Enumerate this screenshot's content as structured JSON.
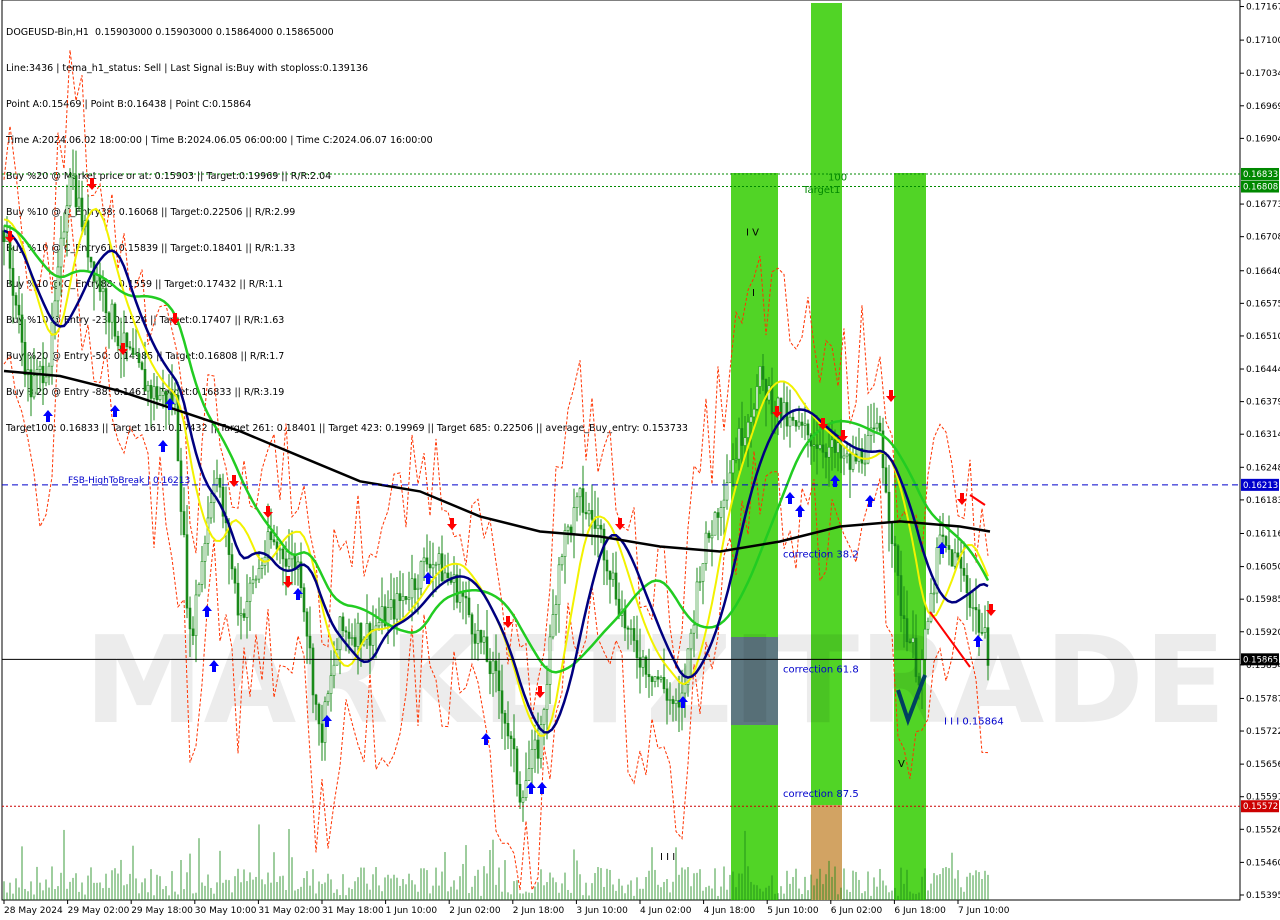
{
  "info_lines": [
    "DOGEUSD-Bin,H1  0.15903000 0.15903000 0.15864000 0.15865000",
    "Line:3436 | tema_h1_status: Sell | Last Signal is:Buy with stoploss:0.139136",
    "Point A:0.15469 | Point B:0.16438 | Point C:0.15864",
    "Time A:2024.06.02 18:00:00 | Time B:2024.06.05 06:00:00 | Time C:2024.06.07 16:00:00",
    "Buy %20 @ Market price or at: 0.15903 || Target:0.19969 || R/R:2.04",
    "Buy %10 @ C_Entry38: 0.16068 || Target:0.22506 || R/R:2.99",
    "Buy %10 @ C_Entry61: 0.15839 || Target:0.18401 || R/R:1.33",
    "Buy %10 @ C_Entry88: 0.1559 || Target:0.17432 || R/R:1.1",
    "Buy %10 @ Entry -23: 0.1524 || Target:0.17407 || R/R:1.63",
    "Buy %20 @ Entry -50: 0.14985 || Target:0.16808 || R/R:1.7",
    "Buy %20 @ Entry -88: 0.1461 || Target:0.16833 || R/R:3.19",
    "Target100: 0.16833 || Target 161: 0.17432 || Target 261: 0.18401 || Target 423: 0.19969 || Target 685: 0.22506 || average_Buy_entry: 0.153733"
  ],
  "colors": {
    "background": "#ffffff",
    "green_band": "#33cc00",
    "blue_box": "#5f6e8c",
    "orange_box": "#d9a066",
    "candle": "#1a8a1a",
    "ma200": "#000000",
    "ma_green": "#22cc22",
    "ma_navy": "#000080",
    "ma_yellow": "#f2f200",
    "envelope": "#ff3300",
    "hline_blue": "#0000cc",
    "hline_green": "#008800",
    "hline_red": "#cc0000",
    "up_arrow": "#0000ff",
    "down_arrow": "#ff0000",
    "price_tag_dark": "#000000",
    "price_tag_blue": "#0000cc",
    "price_tag_green": "#008800",
    "price_tag_red": "#cc0000"
  },
  "watermark": "MARKETZITRADE",
  "chart_data": {
    "type": "candlestick",
    "symbol": "DOGEUSD-Bin",
    "timeframe": "H1",
    "y_ticks": [
      "0.17167",
      "0.17100",
      "0.17034",
      "0.16969",
      "0.16904",
      "0.16833",
      "0.16808",
      "0.16773",
      "0.16708",
      "0.16640",
      "0.16575",
      "0.16510",
      "0.16444",
      "0.16379",
      "0.16314",
      "0.16248",
      "0.16213",
      "0.16183",
      "0.16116",
      "0.16050",
      "0.15985",
      "0.15920",
      "0.15865",
      "0.15854",
      "0.15787",
      "0.15722",
      "0.15656",
      "0.15591",
      "0.15572",
      "0.15526",
      "0.15460",
      "0.15395"
    ],
    "y_range": [
      0.15385,
      0.1718
    ],
    "x_labels": [
      "28 May 2024",
      "29 May 02:00",
      "29 May 18:00",
      "30 May 10:00",
      "31 May 02:00",
      "31 May 18:00",
      "1 Jun 10:00",
      "2 Jun 02:00",
      "2 Jun 18:00",
      "3 Jun 10:00",
      "4 Jun 02:00",
      "4 Jun 18:00",
      "5 Jun 10:00",
      "6 Jun 02:00",
      "6 Jun 18:00",
      "7 Jun 10:00"
    ],
    "horizontal_lines": [
      {
        "label": "FSB-HighToBreak | 0.16213",
        "value": 0.16213,
        "style": "dashed",
        "color": "#0000cc",
        "tag": "0.16213"
      },
      {
        "label": "",
        "value": 0.16833,
        "style": "dotted",
        "color": "#008800",
        "tag": "0.16833"
      },
      {
        "label": "",
        "value": 0.16808,
        "style": "dotted",
        "color": "#008800",
        "tag": "0.16808"
      },
      {
        "label": "",
        "value": 0.15865,
        "style": "solid",
        "color": "#000000",
        "tag": "0.15865"
      },
      {
        "label": "",
        "value": 0.15572,
        "style": "dotted",
        "color": "#cc0000",
        "tag": "0.15572"
      }
    ],
    "annotations": [
      {
        "text": "100",
        "value": 0.1682
      },
      {
        "text": "Target1",
        "value": 0.16795
      },
      {
        "text": "I V",
        "value": 0.1671
      },
      {
        "text": "I",
        "value": 0.1659
      },
      {
        "text": "correction 38.2",
        "value": 0.16068
      },
      {
        "text": "correction 61.8",
        "value": 0.15839
      },
      {
        "text": "correction 87.5",
        "value": 0.1559
      },
      {
        "text": "I I I 0.15864",
        "value": 0.15735
      },
      {
        "text": "V",
        "value": 0.1565
      },
      {
        "text": "I I I",
        "value": 0.15465
      }
    ],
    "last_close": 0.15865
  }
}
